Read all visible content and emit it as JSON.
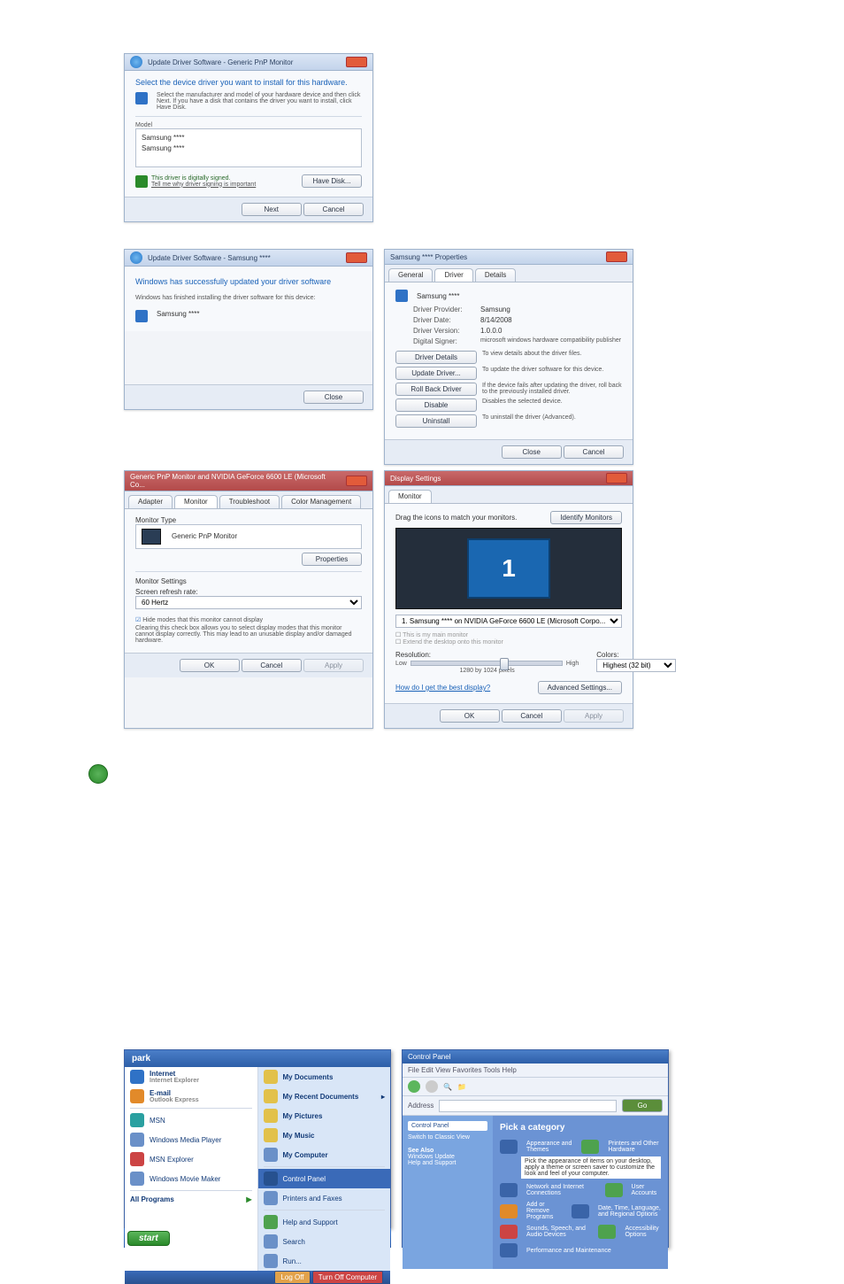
{
  "dlg1": {
    "title": "Update Driver Software - Generic PnP Monitor",
    "heading": "Select the device driver you want to install for this hardware.",
    "instr": "Select the manufacturer and model of your hardware device and then click Next. If you have a disk that contains the driver you want to install, click Have Disk.",
    "model_hdr": "Model",
    "model1": "Samsung ****",
    "model2": "Samsung ****",
    "signed": "This driver is digitally signed.",
    "tell": "Tell me why driver signing is important",
    "havedisk": "Have Disk...",
    "next": "Next",
    "cancel": "Cancel"
  },
  "dlg2": {
    "title": "Update Driver Software - Samsung ****",
    "line1": "Windows has successfully updated your driver software",
    "line2": "Windows has finished installing the driver software for this device:",
    "device": "Samsung ****",
    "close": "Close"
  },
  "props": {
    "title": "Samsung **** Properties",
    "tab_general": "General",
    "tab_driver": "Driver",
    "tab_details": "Details",
    "device": "Samsung ****",
    "provider_l": "Driver Provider:",
    "provider_v": "Samsung",
    "date_l": "Driver Date:",
    "date_v": "8/14/2008",
    "ver_l": "Driver Version:",
    "ver_v": "1.0.0.0",
    "signer_l": "Digital Signer:",
    "signer_v": "microsoft windows hardware compatibility publisher",
    "b_details": "Driver Details",
    "b_details_d": "To view details about the driver files.",
    "b_update": "Update Driver...",
    "b_update_d": "To update the driver software for this device.",
    "b_roll": "Roll Back Driver",
    "b_roll_d": "If the device fails after updating the driver, roll back to the previously installed driver.",
    "b_dis": "Disable",
    "b_dis_d": "Disables the selected device.",
    "b_unin": "Uninstall",
    "b_unin_d": "To uninstall the driver (Advanced).",
    "close": "Close",
    "cancel": "Cancel"
  },
  "monprops": {
    "title": "Generic PnP Monitor and NVIDIA GeForce 6600 LE (Microsoft Co...",
    "tabs": [
      "Adapter",
      "Monitor",
      "Troubleshoot",
      "Color Management"
    ],
    "type_hdr": "Monitor Type",
    "type_val": "Generic PnP Monitor",
    "prop_btn": "Properties",
    "settings_hdr": "Monitor Settings",
    "refresh_lbl": "Screen refresh rate:",
    "refresh_val": "60 Hertz",
    "hide_chk": "Hide modes that this monitor cannot display",
    "hide_note": "Clearing this check box allows you to select display modes that this monitor cannot display correctly. This may lead to an unusable display and/or damaged hardware.",
    "ok": "OK",
    "cancel": "Cancel",
    "apply": "Apply"
  },
  "disp": {
    "title": "Display Settings",
    "tab": "Monitor",
    "drag": "Drag the icons to match your monitors.",
    "identify": "Identify Monitors",
    "mon_num": "1",
    "combo": "1. Samsung **** on NVIDIA GeForce 6600 LE (Microsoft Corpo...",
    "main_chk": "This is my main monitor",
    "extend_chk": "Extend the desktop onto this monitor",
    "res_hdr": "Resolution:",
    "low": "Low",
    "high": "High",
    "res_val": "1280 by 1024 pixels",
    "colors_hdr": "Colors:",
    "colors_val": "Highest (32 bit)",
    "help": "How do I get the best display?",
    "adv": "Advanced Settings...",
    "ok": "OK",
    "cancel": "Cancel",
    "apply": "Apply"
  },
  "start": {
    "user": "park",
    "left": [
      "Internet",
      "Internet Explorer",
      "E-mail",
      "Outlook Express",
      "MSN",
      "Windows Media Player",
      "MSN Explorer",
      "Windows Movie Maker",
      "All Programs"
    ],
    "right": [
      "My Documents",
      "My Recent Documents",
      "My Pictures",
      "My Music",
      "My Computer",
      "Control Panel",
      "Printers and Faxes",
      "Help and Support",
      "Search",
      "Run..."
    ],
    "logoff": "Log Off",
    "turnoff": "Turn Off Computer",
    "startbtn": "start"
  },
  "cp": {
    "title": "Control Panel",
    "menus": "File  Edit  View  Favorites  Tools  Help",
    "addr_lbl": "Address",
    "left_hdr": "Control Panel",
    "left1": "Switch to Classic View",
    "left2": "See Also",
    "left3": "Windows Update",
    "left4": "Help and Support",
    "pick": "Pick a category",
    "c1": "Appearance and Themes",
    "c2": "Printers and Other Hardware",
    "c3": "Network and Internet Connections",
    "c4": "User Accounts",
    "c5": "Add or Remove Programs",
    "c6": "Date, Time, Language, and Regional Options",
    "c7": "Sounds, Speech, and Audio Devices",
    "c8": "Accessibility Options",
    "c9": "Performance and Maintenance",
    "note": "Pick the appearance of items on your desktop, apply a theme or screen saver to customize the look and feel of your computer."
  }
}
